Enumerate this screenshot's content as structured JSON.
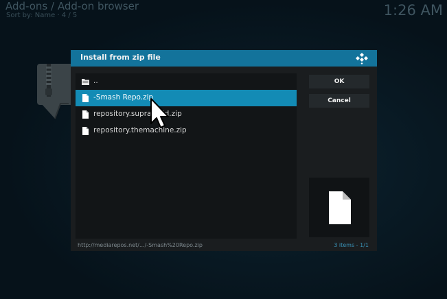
{
  "background": {
    "title": "Add-ons / Add-on browser",
    "subtitle": "Sort by: Name  ·  4 / 5",
    "clock": "1:26 AM"
  },
  "dialog": {
    "title": "Install from zip file",
    "logo_icon": "kodi-logo-icon",
    "accent_color": "#13739b",
    "selection_color": "#138bb5",
    "files": [
      {
        "label": "..",
        "icon": "folder-up-icon",
        "selected": false
      },
      {
        "label": "-Smash Repo.zip",
        "icon": "file-icon",
        "selected": true
      },
      {
        "label": "repository.suprabuild.zip",
        "icon": "file-icon",
        "selected": false
      },
      {
        "label": "repository.themachine.zip",
        "icon": "file-icon",
        "selected": false
      }
    ],
    "ok_label": "OK",
    "cancel_label": "Cancel",
    "preview_icon": "file-icon",
    "path": "http://mediarepos.net/.../-Smash%20Repo.zip",
    "item_count": "3 items - 1/1"
  }
}
